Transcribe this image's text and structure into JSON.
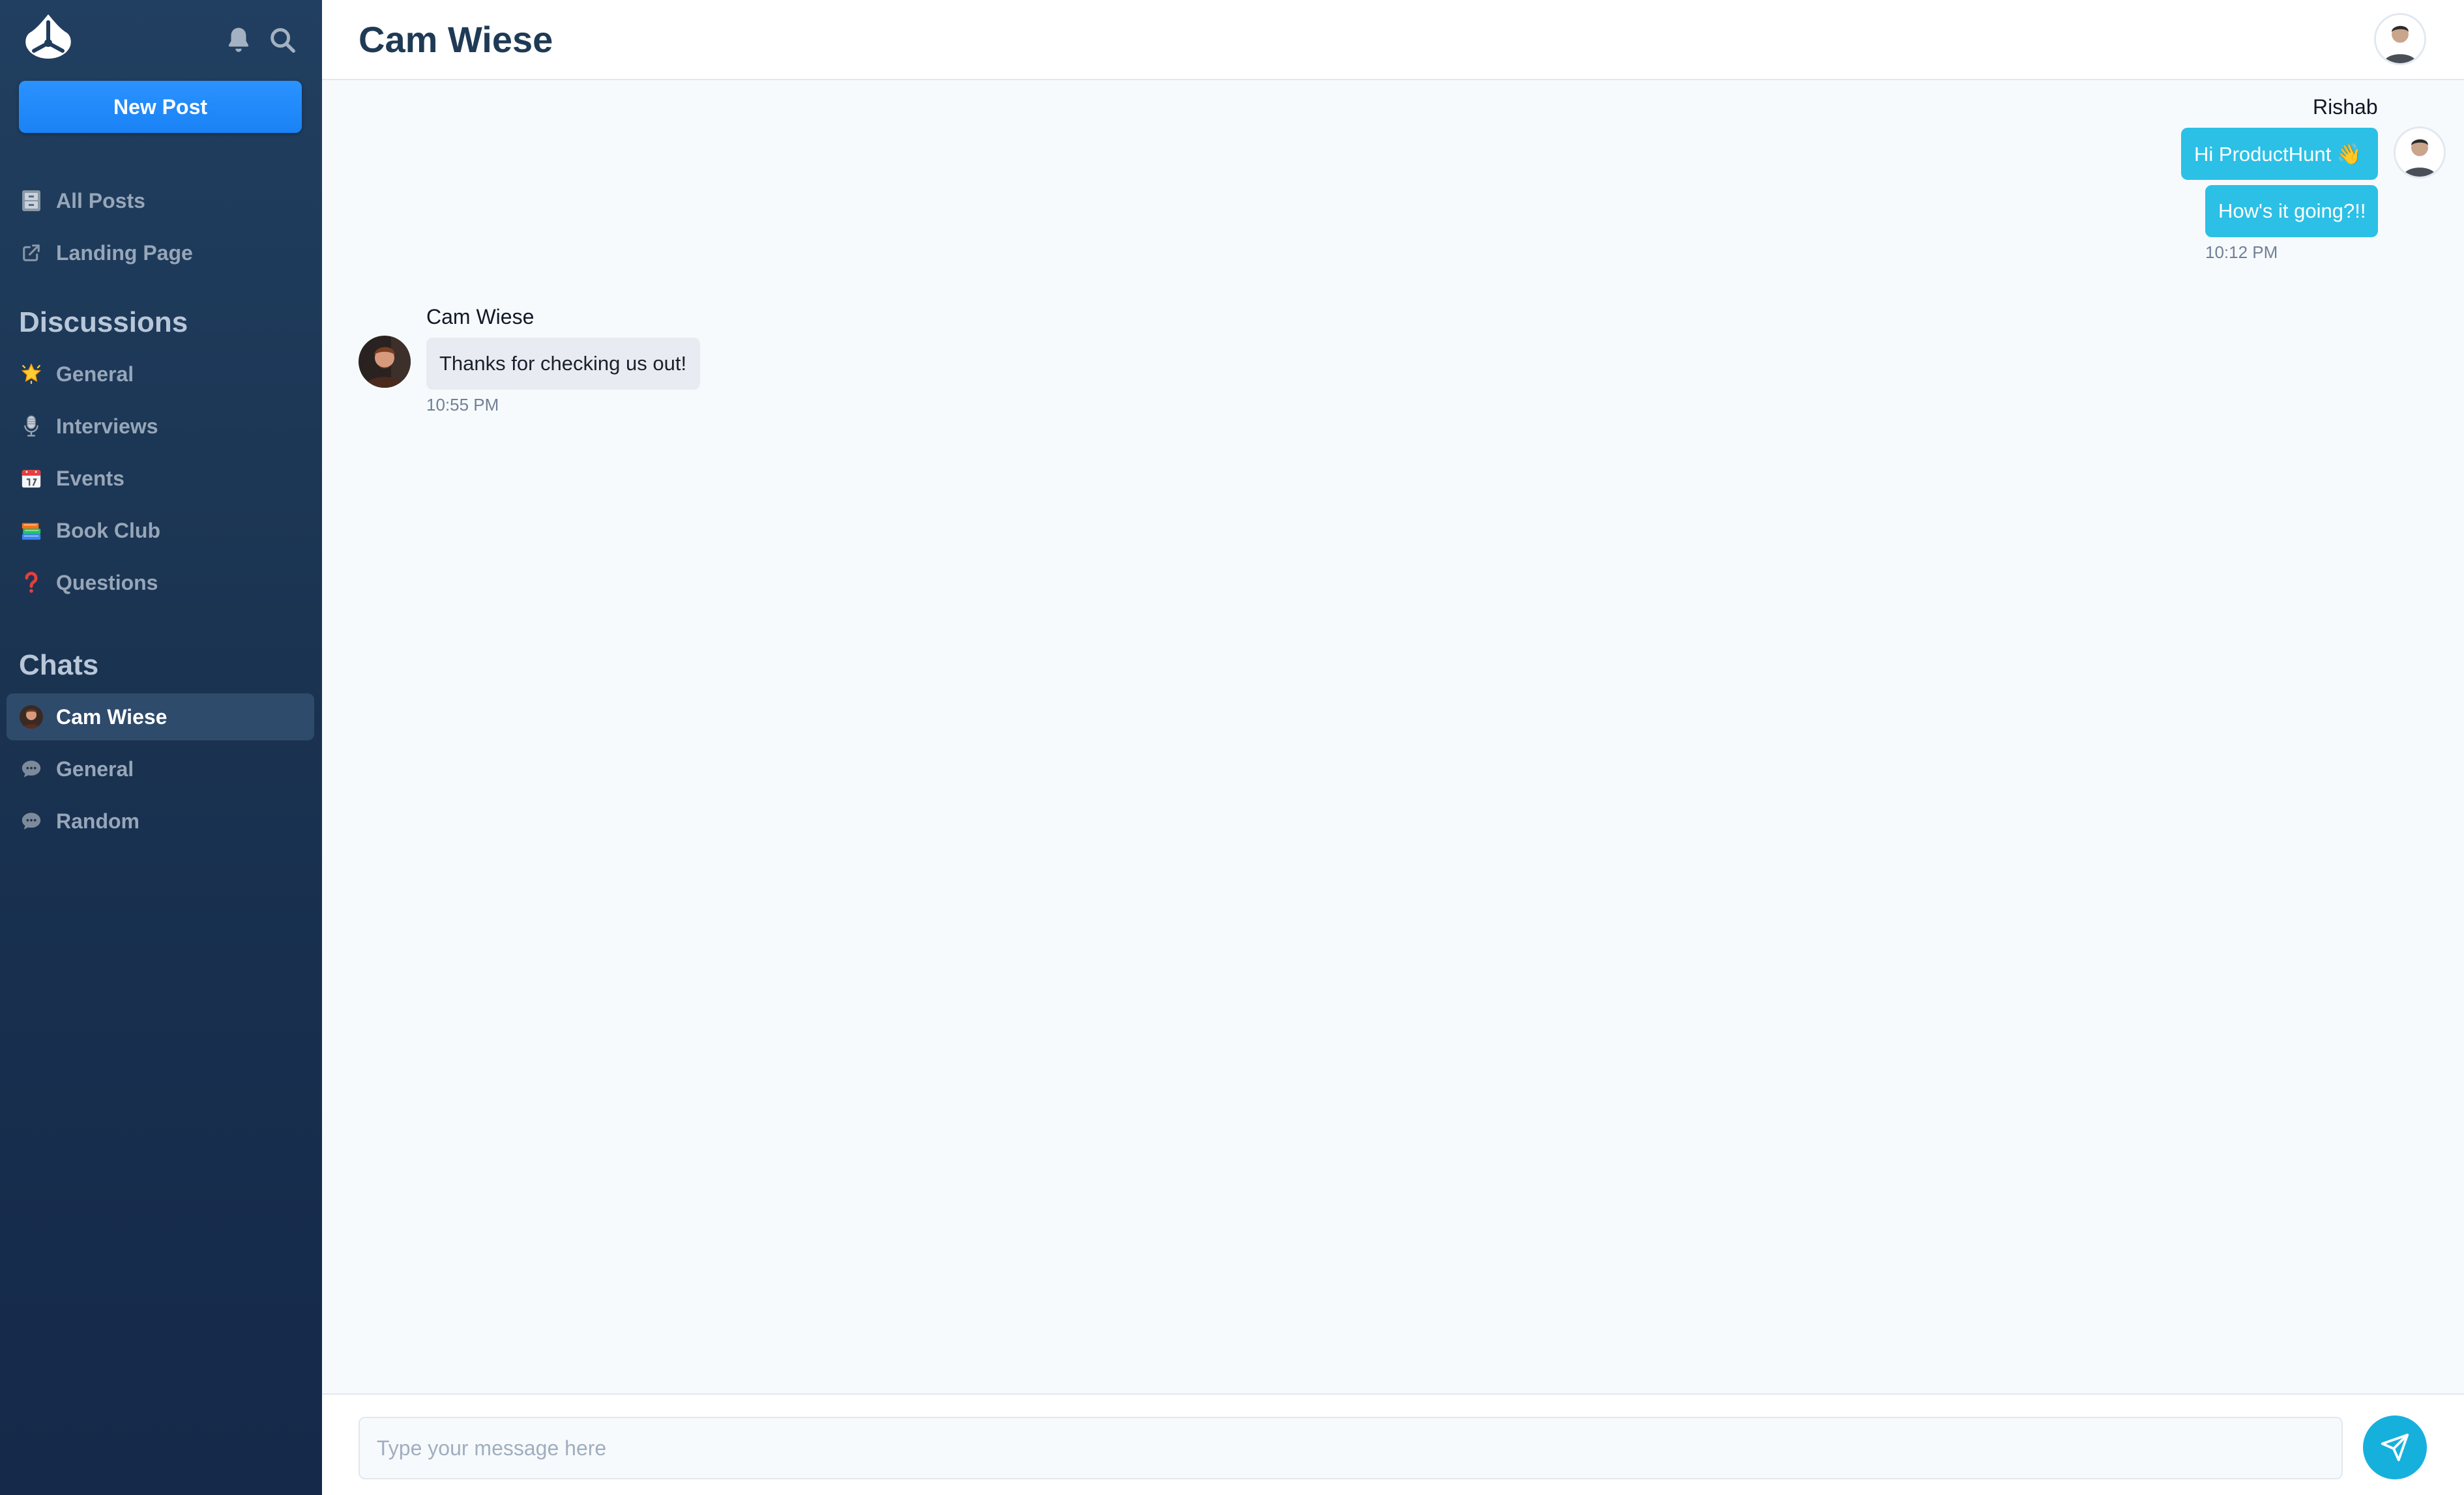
{
  "sidebar": {
    "new_post_label": "New Post",
    "top_links": [
      {
        "label": "All Posts",
        "icon": "cabinet-icon"
      },
      {
        "label": "Landing Page",
        "icon": "external-link-icon"
      }
    ],
    "discussions_title": "Discussions",
    "discussions": [
      {
        "label": "General",
        "icon": "glowing-star-icon"
      },
      {
        "label": "Interviews",
        "icon": "microphone-icon"
      },
      {
        "label": "Events",
        "icon": "calendar-icon"
      },
      {
        "label": "Book Club",
        "icon": "books-icon"
      },
      {
        "label": "Questions",
        "icon": "question-mark-icon"
      }
    ],
    "chats_title": "Chats",
    "chats": [
      {
        "label": "Cam Wiese",
        "icon": "avatar-icon",
        "active": true
      },
      {
        "label": "General",
        "icon": "chat-bubble-icon"
      },
      {
        "label": "Random",
        "icon": "chat-bubble-icon"
      }
    ]
  },
  "header": {
    "title": "Cam Wiese"
  },
  "messages": [
    {
      "sender": "Rishab",
      "direction": "outgoing",
      "lines": [
        "Hi ProductHunt 👋",
        "How's it going?!!"
      ],
      "time": "10:12 PM"
    },
    {
      "sender": "Cam Wiese",
      "direction": "incoming",
      "lines": [
        "Thanks for checking us out!"
      ],
      "time": "10:55 PM"
    }
  ],
  "composer": {
    "placeholder": "Type your message here"
  },
  "colors": {
    "accent": "#1a82f5",
    "outgoing_bubble": "#2cc0e6",
    "send_button": "#16b0dd",
    "sidebar_bg": "#1a3351"
  }
}
